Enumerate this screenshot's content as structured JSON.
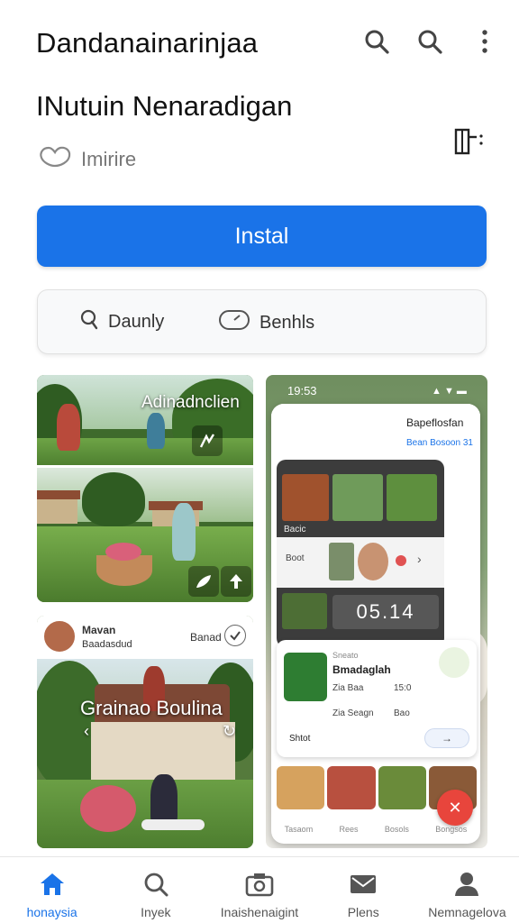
{
  "header": {
    "app_title": "Dandanainarinjaa",
    "page_title": "INutuin Nenaradigan",
    "sub_label": "Imirire"
  },
  "install_label": "Instal",
  "chips": [
    {
      "label": "Daunly",
      "icon": "search-icon"
    },
    {
      "label": "Benhls",
      "icon": "speed-icon"
    }
  ],
  "card_a": {
    "overlay_title": "Adinadnclien"
  },
  "card_b": {
    "header_name": "Mavan",
    "header_sub": "Baadasdud",
    "header_right": "Banad",
    "overlay_title": "Grainao Boulina"
  },
  "card_c": {
    "status_time": "19:53",
    "phone_title": "Bapeflosfan",
    "phone_sub": "Bean Bosoon 31",
    "thumb_label": "Bacic",
    "row_label": "Boot",
    "counter": "05.14",
    "app_name": "Bmadaglah",
    "app_tag": "Sneato",
    "meta_1": "Zia Baa",
    "meta_2": "15:0",
    "meta_3": "Zia Seagn",
    "meta_4": "Bao",
    "feature": "Shtot",
    "nav": [
      "Tasaom",
      "Rees",
      "Bosols",
      "Bongsos"
    ]
  },
  "bottom_nav": [
    {
      "label": "honaysia",
      "icon": "home-icon",
      "active": true
    },
    {
      "label": "Inyek",
      "icon": "search-icon",
      "active": false
    },
    {
      "label": "Inaishenaigint",
      "icon": "camera-icon",
      "active": false
    },
    {
      "label": "Plens",
      "icon": "mail-icon",
      "active": false
    },
    {
      "label": "Nemnagelova",
      "icon": "profile-icon",
      "active": false
    }
  ],
  "colors": {
    "accent": "#1a73e8",
    "fab": "#e8453c"
  }
}
